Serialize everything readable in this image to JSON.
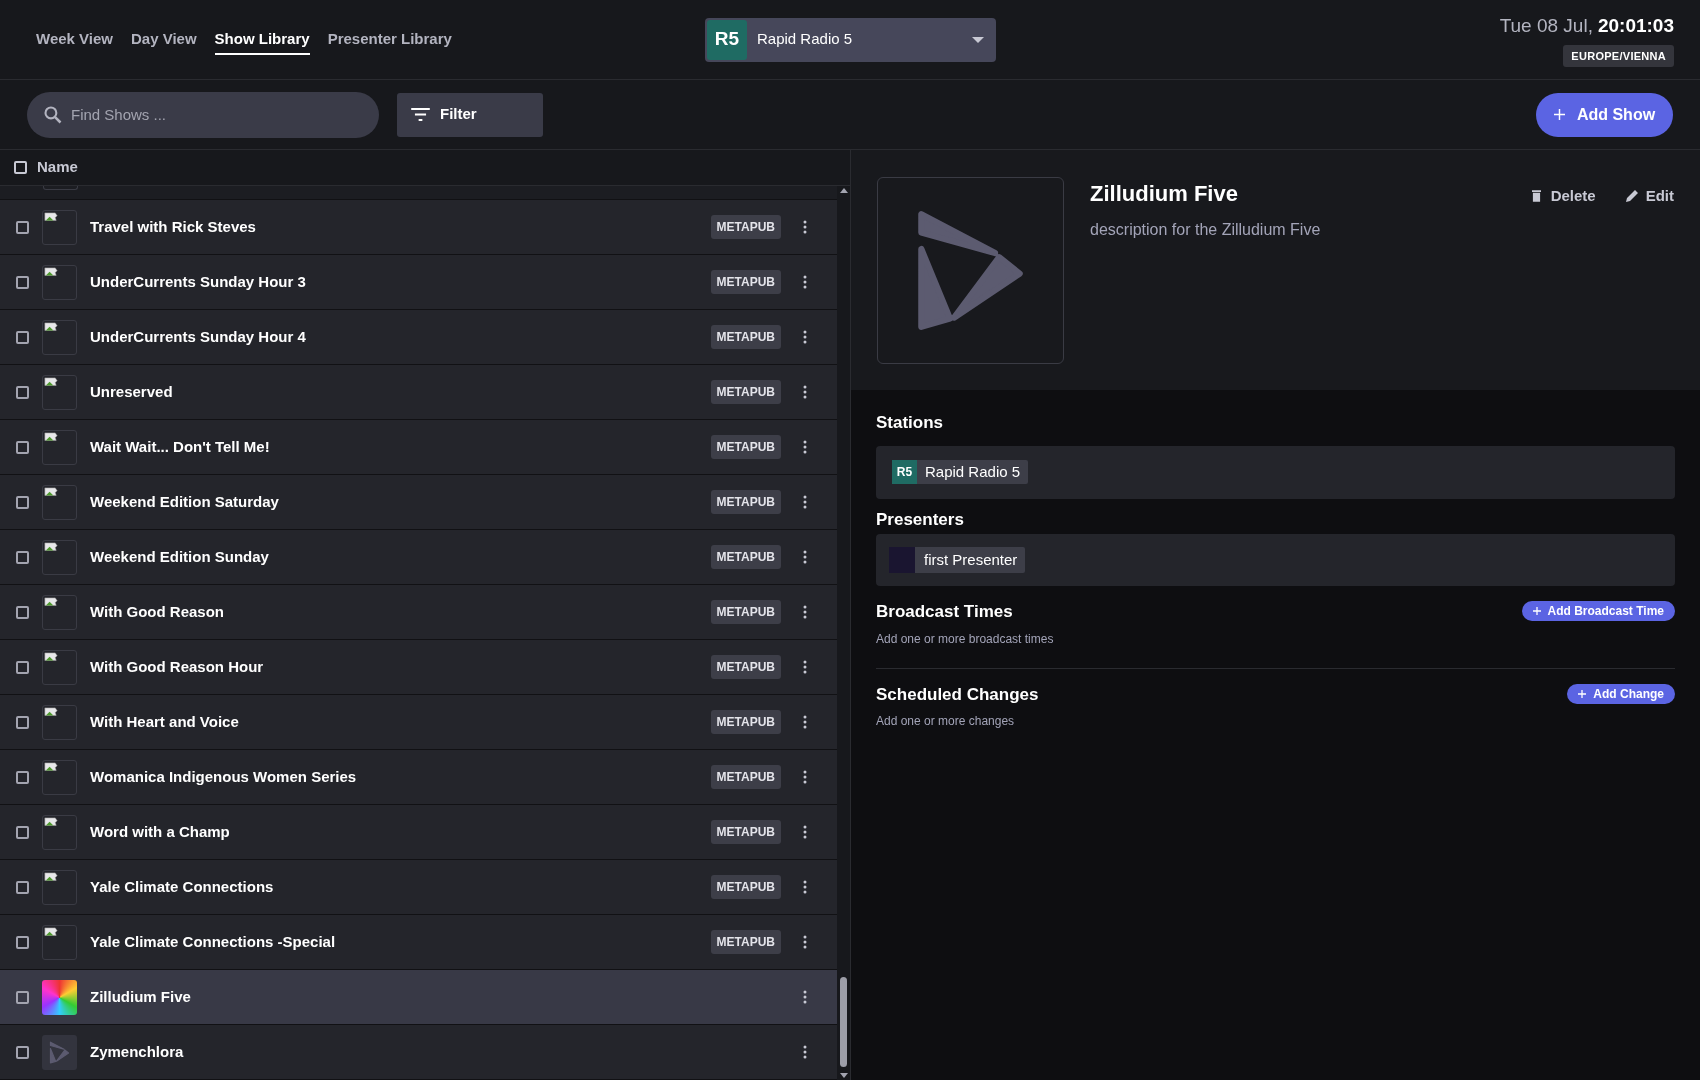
{
  "nav": {
    "tabs": [
      {
        "label": "Week View",
        "selected": false
      },
      {
        "label": "Day View",
        "selected": false
      },
      {
        "label": "Show Library",
        "selected": true
      },
      {
        "label": "Presenter Library",
        "selected": false
      }
    ]
  },
  "station_select": {
    "logo": "R5",
    "value": "Rapid Radio 5"
  },
  "clock": {
    "date": "Tue 08 Jul,",
    "time": "20:01:03",
    "timezone": "EUROPE/VIENNA"
  },
  "toolbar": {
    "search": {
      "placeholder": "Find Shows ..."
    },
    "filter": "Filter",
    "add_button": "Add Show"
  },
  "table": {
    "columns": [
      {
        "label": "Name",
        "checked": false
      }
    ],
    "rows": [
      {
        "name": "Travel with Rick Steves",
        "kind": "broken",
        "badge": "METAPUB",
        "checked": false,
        "selected": false
      },
      {
        "name": "UnderCurrents Sunday Hour 3",
        "kind": "broken",
        "badge": "METAPUB",
        "checked": false,
        "selected": false
      },
      {
        "name": "UnderCurrents Sunday Hour 4",
        "kind": "broken",
        "badge": "METAPUB",
        "checked": false,
        "selected": false
      },
      {
        "name": "Unreserved",
        "kind": "broken",
        "badge": "METAPUB",
        "checked": false,
        "selected": false
      },
      {
        "name": "Wait Wait... Don't Tell Me!",
        "kind": "broken",
        "badge": "METAPUB",
        "checked": false,
        "selected": false
      },
      {
        "name": "Weekend Edition Saturday",
        "kind": "broken",
        "badge": "METAPUB",
        "checked": false,
        "selected": false
      },
      {
        "name": "Weekend Edition Sunday",
        "kind": "broken",
        "badge": "METAPUB",
        "checked": false,
        "selected": false
      },
      {
        "name": "With Good Reason",
        "kind": "broken",
        "badge": "METAPUB",
        "checked": false,
        "selected": false
      },
      {
        "name": "With Good Reason Hour",
        "kind": "broken",
        "badge": "METAPUB",
        "checked": false,
        "selected": false
      },
      {
        "name": "With Heart and Voice",
        "kind": "broken",
        "badge": "METAPUB",
        "checked": false,
        "selected": false
      },
      {
        "name": "Womanica Indigenous Women Series",
        "kind": "broken",
        "badge": "METAPUB",
        "checked": false,
        "selected": false
      },
      {
        "name": "Word with a Champ",
        "kind": "broken",
        "badge": "METAPUB",
        "checked": false,
        "selected": false
      },
      {
        "name": "Yale Climate Connections",
        "kind": "broken",
        "badge": "METAPUB",
        "checked": false,
        "selected": false
      },
      {
        "name": "Yale Climate Connections -Special",
        "kind": "broken",
        "badge": "METAPUB",
        "checked": false,
        "selected": false
      },
      {
        "name": "Zilludium Five",
        "kind": "photo",
        "checked": false,
        "selected": true
      },
      {
        "name": "Zymenchlora",
        "kind": "logo",
        "checked": false,
        "selected": false
      }
    ]
  },
  "detail": {
    "title": "Zilludium Five",
    "description": "description for the Zilludium Five",
    "delete": "Delete",
    "edit": "Edit",
    "stations_heading": "Stations",
    "stations": [
      {
        "logo": "R5",
        "name": "Rapid Radio 5"
      }
    ],
    "presenters_heading": "Presenters",
    "presenters": [
      {
        "name": "first Presenter"
      }
    ],
    "sections": [
      {
        "heading": "Broadcast Times",
        "hint": "Add one or more broadcast times",
        "button": "Add Broadcast Time"
      },
      {
        "heading": "Scheduled Changes",
        "hint": "Add one or more changes",
        "button": "Add Change"
      }
    ]
  }
}
